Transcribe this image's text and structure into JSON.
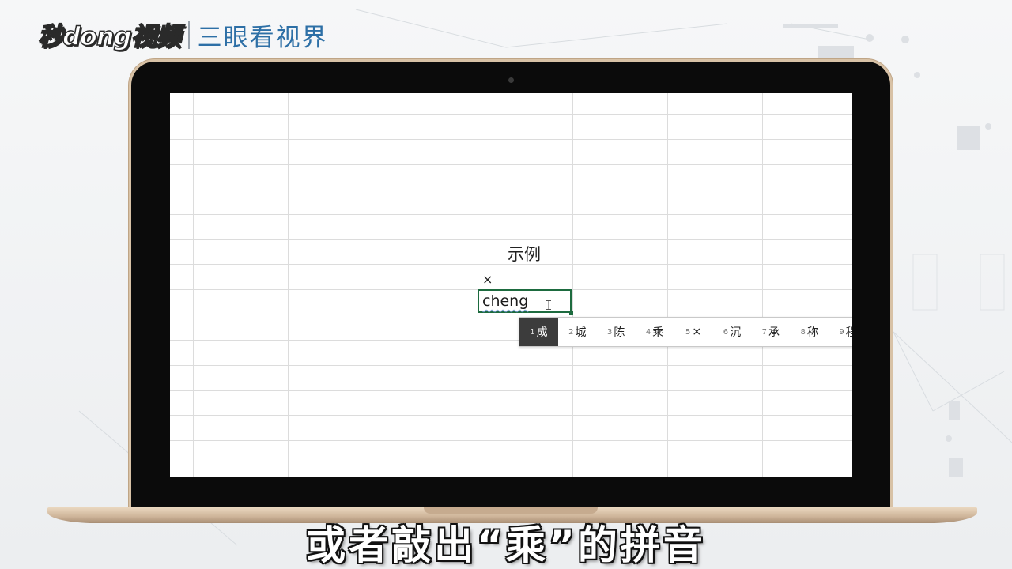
{
  "logo": {
    "brand": "秒dong视频",
    "channel": "三眼看视界"
  },
  "sheet": {
    "title": "示例",
    "times_symbol": "×",
    "input_value": "cheng"
  },
  "ime": {
    "candidates": [
      {
        "num": "1",
        "text": "成",
        "selected": true
      },
      {
        "num": "2",
        "text": "城"
      },
      {
        "num": "3",
        "text": "陈"
      },
      {
        "num": "4",
        "text": "乘"
      },
      {
        "num": "5",
        "text": "×"
      },
      {
        "num": "6",
        "text": "沉"
      },
      {
        "num": "7",
        "text": "承"
      },
      {
        "num": "8",
        "text": "称"
      },
      {
        "num": "9",
        "text": "程"
      }
    ]
  },
  "subtitle": "或者敲出“乘”的拼音",
  "colors": {
    "cell_border": "#1d6b3f",
    "ime_selected": "#3c3c3c",
    "channel_blue": "#2d6fa6"
  }
}
